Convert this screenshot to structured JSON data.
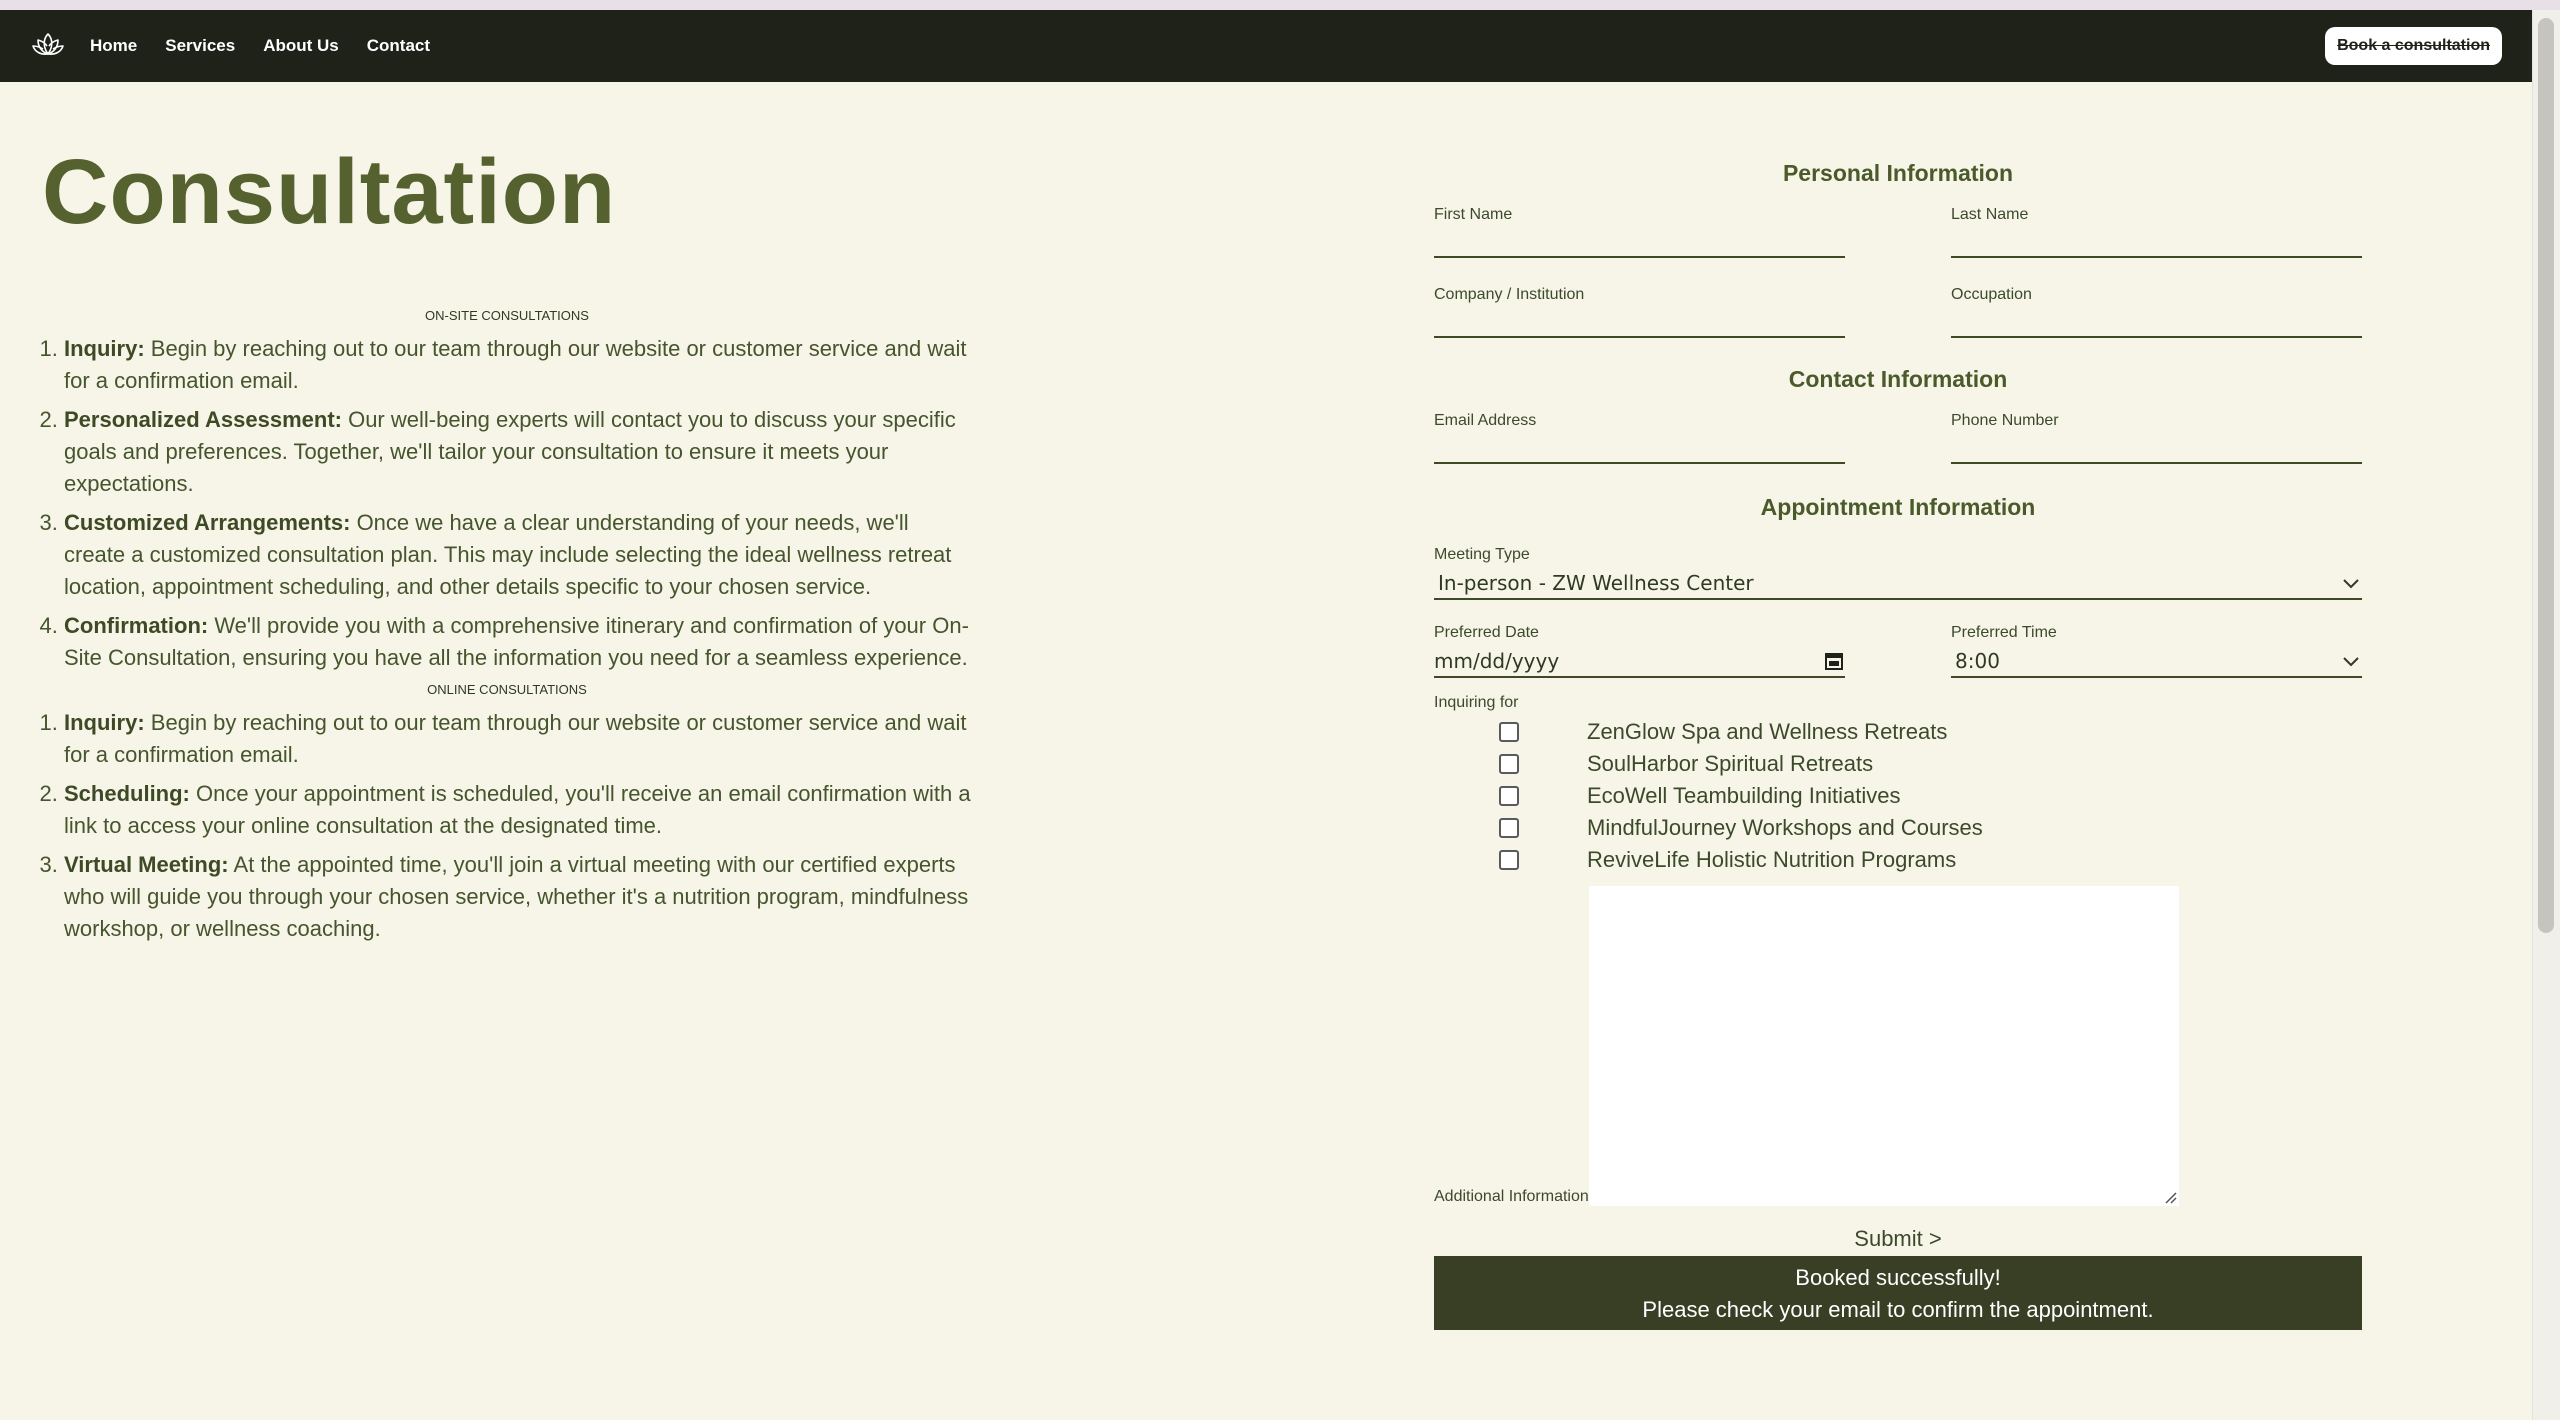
{
  "nav": {
    "links": [
      "Home",
      "Services",
      "About Us",
      "Contact"
    ],
    "book_label": "Book a consultation"
  },
  "page": {
    "title": "Consultation"
  },
  "onsite": {
    "caption": "ON-SITE CONSULTATIONS",
    "steps": [
      {
        "title": "Inquiry:",
        "text": " Begin by reaching out to our team through our website or customer service and wait for a confirmation email."
      },
      {
        "title": "Personalized Assessment:",
        "text": " Our well-being experts will contact you to discuss your specific goals and preferences. Together, we'll tailor your consultation to ensure it meets your expectations."
      },
      {
        "title": "Customized Arrangements:",
        "text": " Once we have a clear understanding of your needs, we'll create a customized consultation plan. This may include selecting the ideal wellness retreat location, appointment scheduling, and other details specific to your chosen service."
      },
      {
        "title": "Confirmation:",
        "text": " We'll provide you with a comprehensive itinerary and confirmation of your On-Site Consultation, ensuring you have all the information you need for a seamless experience."
      }
    ]
  },
  "online": {
    "caption": "ONLINE CONSULTATIONS",
    "steps": [
      {
        "title": "Inquiry:",
        "text": " Begin by reaching out to our team through our website or customer service and wait for a confirmation email."
      },
      {
        "title": "Scheduling:",
        "text": " Once your appointment is scheduled, you'll receive an email confirmation with a link to access your online consultation at the designated time."
      },
      {
        "title": "Virtual Meeting:",
        "text": " At the appointed time, you'll join a virtual meeting with our certified experts who will guide you through your chosen service, whether it's a nutrition program, mindfulness workshop, or wellness coaching."
      }
    ]
  },
  "form": {
    "personal_heading": "Personal Information",
    "first_name_label": "First Name",
    "last_name_label": "Last Name",
    "company_label": "Company / Institution",
    "occupation_label": "Occupation",
    "contact_heading": "Contact Information",
    "email_label": "Email Address",
    "phone_label": "Phone Number",
    "appointment_heading": "Appointment Information",
    "meeting_type_label": "Meeting Type",
    "meeting_type_value": "In-person - ZW Wellness Center",
    "date_label": "Preferred Date",
    "date_placeholder": "mm/dd/yyyy",
    "time_label": "Preferred Time",
    "time_value": "8:00",
    "inquiring_label": "Inquiring for",
    "services": [
      "ZenGlow Spa and Wellness Retreats",
      "SoulHarbor Spiritual Retreats",
      "EcoWell Teambuilding Initiatives",
      "MindfulJourney Workshops and Courses",
      "ReviveLife Holistic Nutrition Programs"
    ],
    "additional_label": "Additional Information",
    "submit_label": "Submit >",
    "success_line1": "Booked successfully!",
    "success_line2": "Please check your email to confirm the appointment."
  }
}
